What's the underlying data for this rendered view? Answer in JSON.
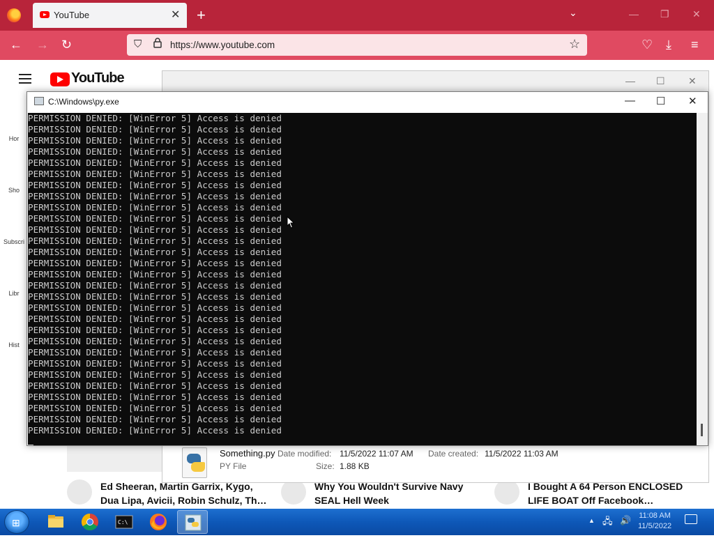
{
  "browser": {
    "tab_title": "YouTube",
    "tab_close": "✕",
    "new_tab": "+",
    "tab_list": "⌄",
    "minimize": "—",
    "restore": "❐",
    "close": "✕",
    "url": "https://www.youtube.com",
    "back": "←",
    "forward": "→",
    "reload": "↻",
    "shield": "⛉",
    "lock": "🔒",
    "star": "☆",
    "pocket": "♡",
    "download": "⤓",
    "menu": "≡",
    "accent": "#b8243a"
  },
  "youtube": {
    "logo_text": "YouTube",
    "sidebar": [
      "Hor",
      "Sho",
      "Subscri",
      "Libr",
      "Hist"
    ],
    "videos": [
      {
        "title_line1": "Ed Sheeran, Martin Garrix, Kygo,",
        "title_line2": "Dua Lipa, Avicii, Robin Schulz, Th…"
      },
      {
        "title_line1": "Why You Wouldn't Survive Navy",
        "title_line2": "SEAL Hell Week"
      },
      {
        "title_line1": "I Bought A 64 Person ENCLOSED",
        "title_line2": "LIFE BOAT Off Facebook…"
      }
    ]
  },
  "explorer": {
    "file_name": "Something.py",
    "file_type": "PY File",
    "date_modified_label": "Date modified:",
    "date_modified": "11/5/2022 11:07 AM",
    "date_created_label": "Date created:",
    "date_created": "11/5/2022 11:03 AM",
    "size_label": "Size:",
    "size": "1.88 KB",
    "minimize": "—",
    "restore": "☐",
    "close": "✕"
  },
  "console": {
    "title": "C:\\Windows\\py.exe",
    "minimize": "—",
    "restore": "☐",
    "close": "✕",
    "line": "PERMISSION DENIED: [WinError 5] Access is denied",
    "line_count": 29
  },
  "taskbar": {
    "time": "11:08 AM",
    "date": "11/5/2022",
    "start_flag": "⊞"
  }
}
